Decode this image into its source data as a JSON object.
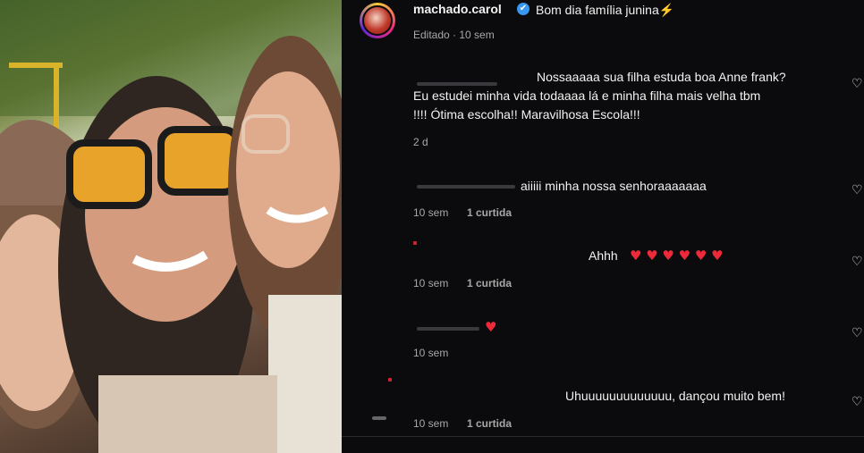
{
  "post": {
    "username": "machado.carol",
    "verified_icon": "✔",
    "caption": "Bom dia família junina⚡",
    "meta": "Editado · 10 sem"
  },
  "comments": [
    {
      "text_line1": "Nossaaaaa sua filha estuda boa Anne frank?",
      "text_line2": "Eu estudei minha vida todaaaa lá e minha filha mais velha tbm",
      "text_line3": "!!!! Ótima escolha!! Maravilhosa Escola!!!",
      "time": "2 d"
    },
    {
      "text": "aiiiii minha nossa senhoraaaaaaa",
      "time": "10 sem",
      "likes": "1 curtida"
    },
    {
      "text": "Ahhh",
      "hearts": "♥ ♥ ♥ ♥ ♥ ♥",
      "time": "10 sem",
      "likes": "1 curtida"
    },
    {
      "hearts": "♥",
      "time": "10 sem"
    },
    {
      "text": "Uhuuuuuuuuuuuuu, dançou muito bem!",
      "time": "10 sem",
      "likes": "1 curtida"
    }
  ],
  "icons": {
    "like": "♡"
  },
  "colors": {
    "background": "#0b0b0d",
    "verified": "#3897f0",
    "heart": "#ed2a3a",
    "muted": "#a8a8a8"
  }
}
